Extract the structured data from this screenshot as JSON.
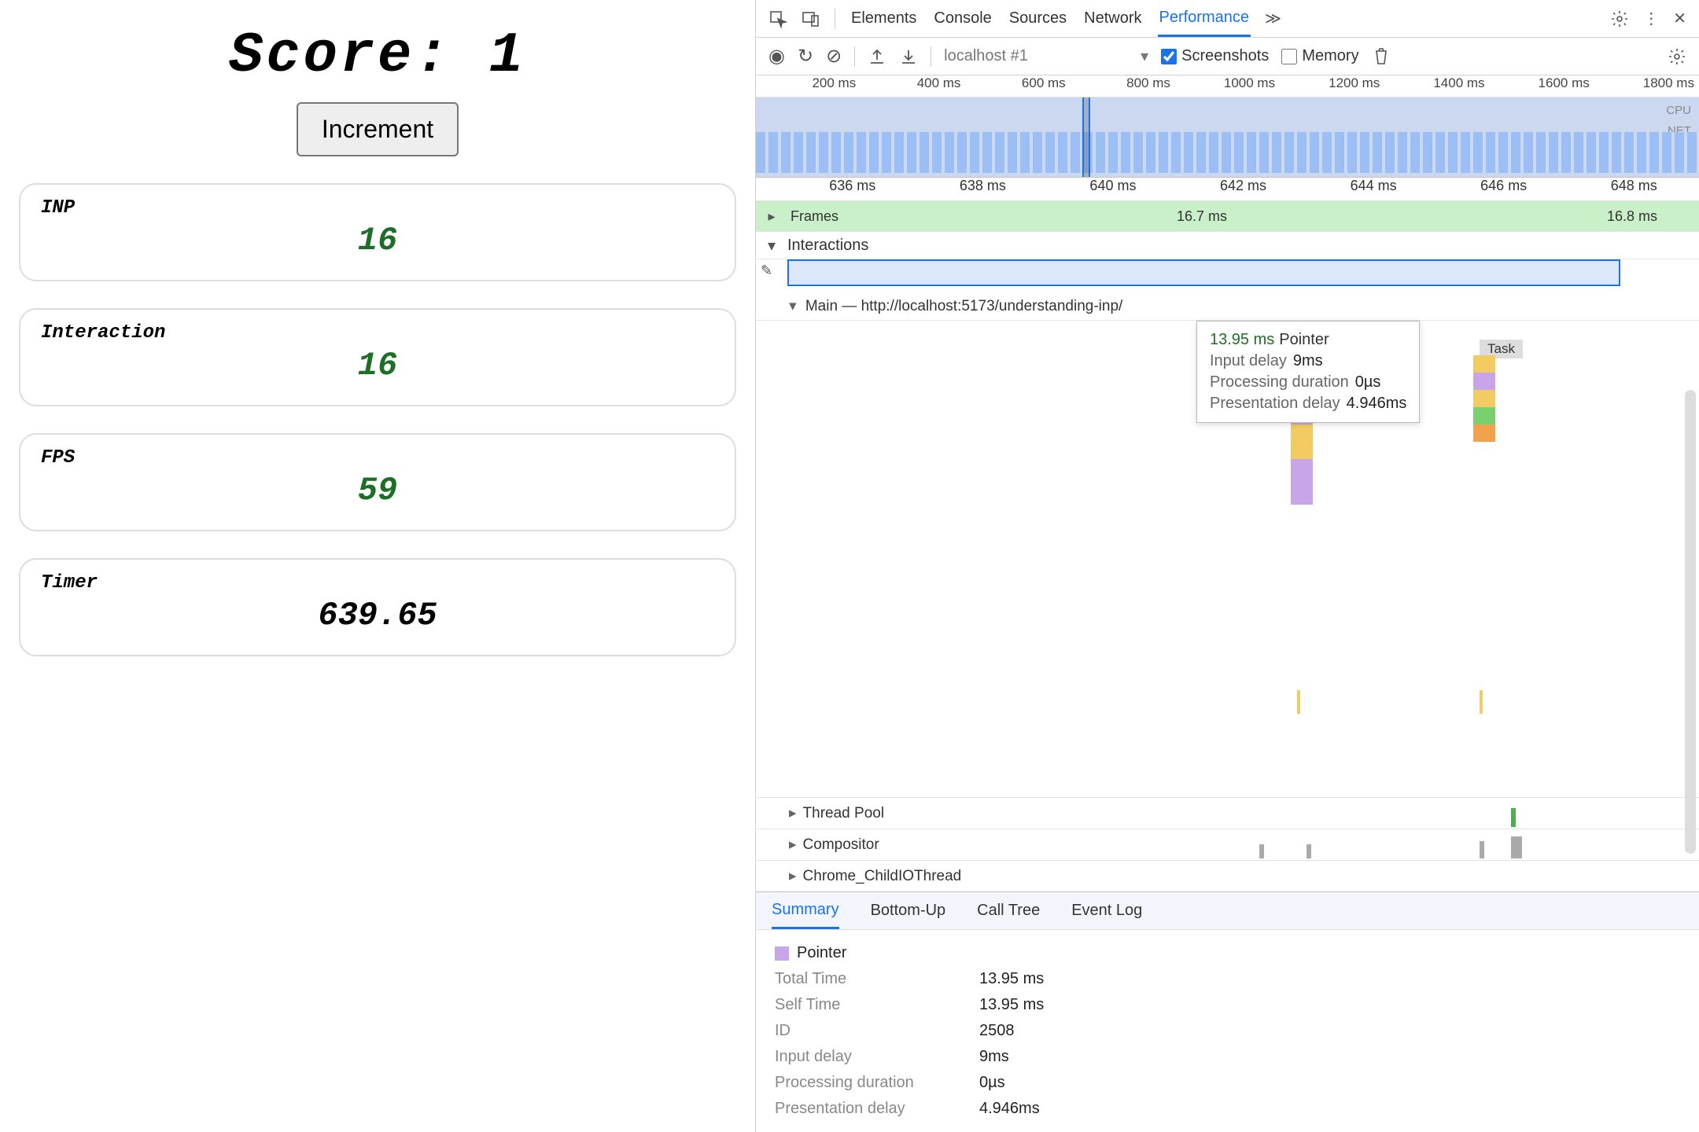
{
  "app": {
    "score_label": "Score: 1",
    "increment_label": "Increment",
    "cards": {
      "inp": {
        "label": "INP",
        "value": "16"
      },
      "interaction": {
        "label": "Interaction",
        "value": "16"
      },
      "fps": {
        "label": "FPS",
        "value": "59"
      },
      "timer": {
        "label": "Timer",
        "value": "639.65"
      }
    }
  },
  "devtools": {
    "tabs": [
      "Elements",
      "Console",
      "Sources",
      "Network",
      "Performance"
    ],
    "active_tab": 4,
    "more_glyph": "≫",
    "toolbar": {
      "profile": "localhost #1",
      "screenshots_label": "Screenshots",
      "screenshots_checked": true,
      "memory_label": "Memory",
      "memory_checked": false
    },
    "overview_ticks": [
      "200 ms",
      "400 ms",
      "600 ms",
      "800 ms",
      "1000 ms",
      "1200 ms",
      "1400 ms",
      "1600 ms",
      "1800 ms"
    ],
    "overview_labels": {
      "cpu": "CPU",
      "net": "NET"
    },
    "detail_ticks": [
      "636 ms",
      "638 ms",
      "640 ms",
      "642 ms",
      "644 ms",
      "646 ms",
      "648 ms"
    ],
    "tracks": {
      "frames_label": "Frames",
      "frame_a": "16.7 ms",
      "frame_b": "16.8 ms",
      "interactions_label": "Interactions",
      "main_label": "Main — http://localhost:5173/understanding-inp/",
      "thread_pool": "Thread Pool",
      "compositor": "Compositor",
      "child_io": "Chrome_ChildIOThread",
      "task_label": "Task"
    },
    "tooltip": {
      "time": "13.95 ms",
      "name": "Pointer",
      "rows": [
        {
          "k": "Input delay",
          "v": "9ms"
        },
        {
          "k": "Processing duration",
          "v": "0µs"
        },
        {
          "k": "Presentation delay",
          "v": "4.946ms"
        }
      ]
    },
    "bottom_tabs": [
      "Summary",
      "Bottom-Up",
      "Call Tree",
      "Event Log"
    ],
    "bottom_active": 0,
    "summary": {
      "pointer": "Pointer",
      "rows": [
        {
          "k": "Total Time",
          "v": "13.95 ms"
        },
        {
          "k": "Self Time",
          "v": "13.95 ms"
        },
        {
          "k": "ID",
          "v": "2508"
        },
        {
          "k": "Input delay",
          "v": "9ms"
        },
        {
          "k": "Processing duration",
          "v": "0µs"
        },
        {
          "k": "Presentation delay",
          "v": "4.946ms"
        }
      ]
    }
  }
}
